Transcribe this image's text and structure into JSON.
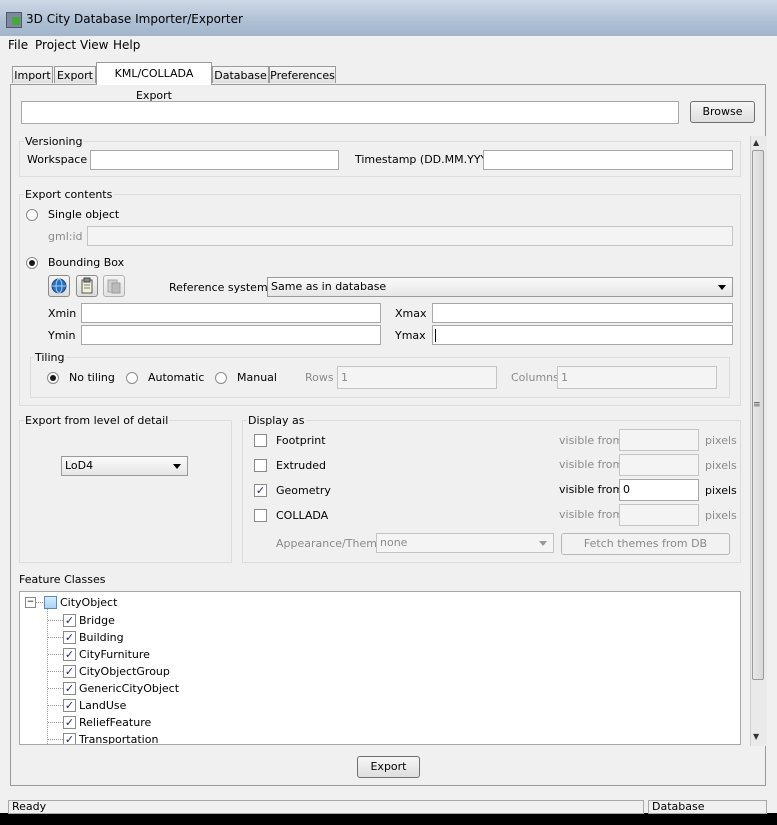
{
  "window": {
    "title": "3D City Database Importer/Exporter"
  },
  "menu": [
    "File",
    "Project",
    "View",
    "Help"
  ],
  "tabs": [
    "Import",
    "Export",
    "KML/COLLADA Export",
    "Database",
    "Preferences"
  ],
  "browse_label": "Browse",
  "versioning": {
    "title": "Versioning",
    "workspace_label": "Workspace",
    "timestamp_label": "Timestamp (DD.MM.YYY)"
  },
  "export_contents": {
    "title": "Export contents",
    "single_object": "Single object",
    "gmlid_label": "gml:id",
    "bounding_box": "Bounding Box",
    "reference_system_label": "Reference system",
    "reference_system_value": "Same as in database",
    "xmin": "Xmin",
    "xmax": "Xmax",
    "ymin": "Ymin",
    "ymax": "Ymax",
    "tiling": {
      "title": "Tiling",
      "no_tiling": "No tiling",
      "automatic": "Automatic",
      "manual": "Manual",
      "rows_label": "Rows",
      "rows_value": "1",
      "columns_label": "Columns",
      "columns_value": "1"
    }
  },
  "lod": {
    "title": "Export from level of detail",
    "value": "LoD4"
  },
  "display_as": {
    "title": "Display as",
    "options": [
      {
        "label": "Footprint",
        "checked": false,
        "visible_label": "visible from",
        "value": "",
        "unit": "pixels"
      },
      {
        "label": "Extruded",
        "checked": false,
        "visible_label": "visible from",
        "value": "",
        "unit": "pixels"
      },
      {
        "label": "Geometry",
        "checked": true,
        "visible_label": "visible from",
        "value": "0",
        "unit": "pixels"
      },
      {
        "label": "COLLADA",
        "checked": false,
        "visible_label": "visible from",
        "value": "",
        "unit": "pixels"
      }
    ],
    "appearance_label": "Appearance/Theme",
    "appearance_value": "none",
    "fetch_label": "Fetch themes from DB"
  },
  "feature_classes": {
    "title": "Feature Classes",
    "root": "CityObject",
    "items": [
      "Bridge",
      "Building",
      "CityFurniture",
      "CityObjectGroup",
      "GenericCityObject",
      "LandUse",
      "ReliefFeature",
      "Transportation"
    ]
  },
  "export_label": "Export",
  "status": {
    "left": "Ready",
    "right": "Database disconnected"
  },
  "colors": {
    "title_bar": "#b6c6da",
    "window_bg": "#f0f0f0",
    "checkbox_tick": "#1a2a6a"
  }
}
